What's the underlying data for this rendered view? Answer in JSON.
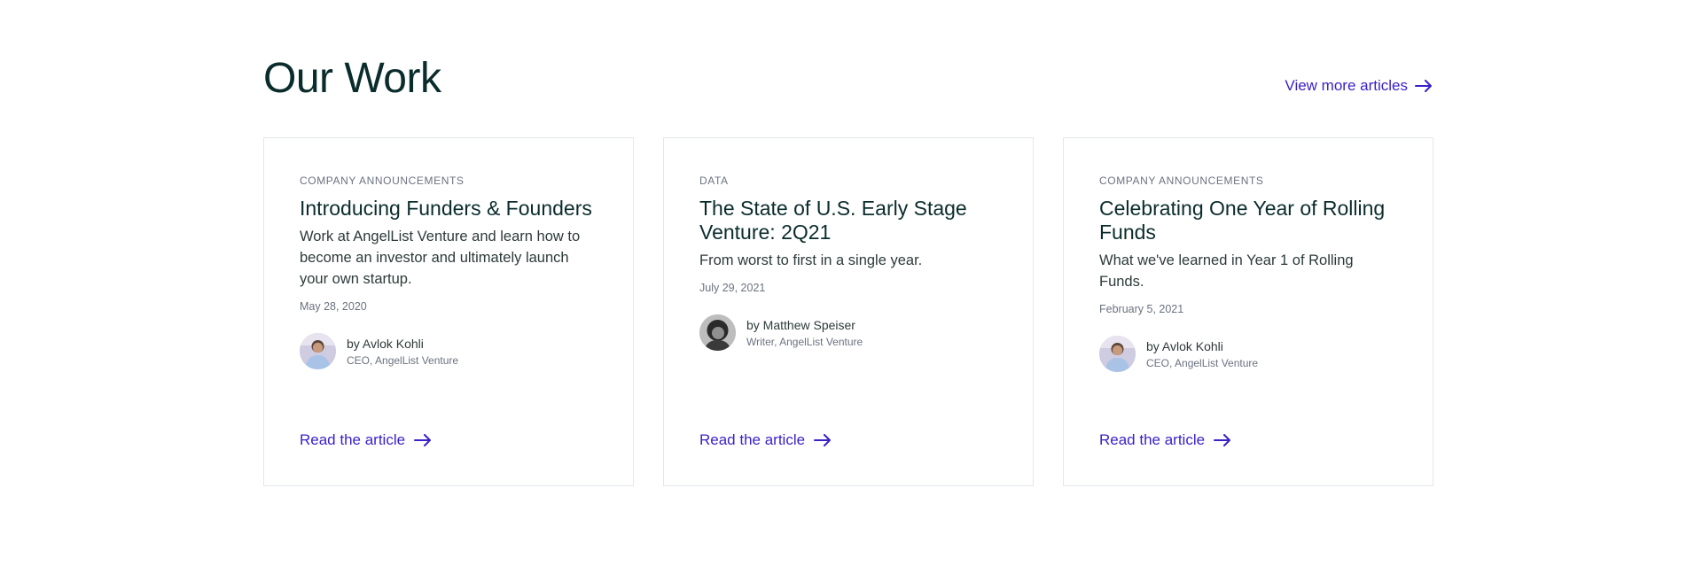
{
  "section": {
    "title": "Our Work",
    "view_more_label": "View more articles"
  },
  "colors": {
    "accent": "#3b1fc7",
    "title": "#0b2c2c",
    "muted": "#6b7280",
    "border": "#e5e7eb"
  },
  "cards": [
    {
      "category": "COMPANY ANNOUNCEMENTS",
      "title": "Introducing Funders & Founders",
      "description": "Work at AngelList Venture and learn how to become an investor and ultimately launch your own startup.",
      "date": "May 28, 2020",
      "author_name": "by Avlok Kohli",
      "author_role": "CEO, AngelList Venture",
      "link_label": "Read the article"
    },
    {
      "category": "DATA",
      "title": "The State of U.S. Early Stage Venture: 2Q21",
      "description": "From worst to first in a single year.",
      "date": "July 29, 2021",
      "author_name": "by  Matthew Speiser",
      "author_role": "Writer, AngelList Venture",
      "link_label": "Read the article"
    },
    {
      "category": "COMPANY ANNOUNCEMENTS",
      "title": "Celebrating One Year of Rolling Funds",
      "description": "What we've learned in Year 1 of Rolling Funds.",
      "date": "February 5, 2021",
      "author_name": "by Avlok Kohli",
      "author_role": "CEO, AngelList Venture",
      "link_label": "Read the article"
    }
  ]
}
